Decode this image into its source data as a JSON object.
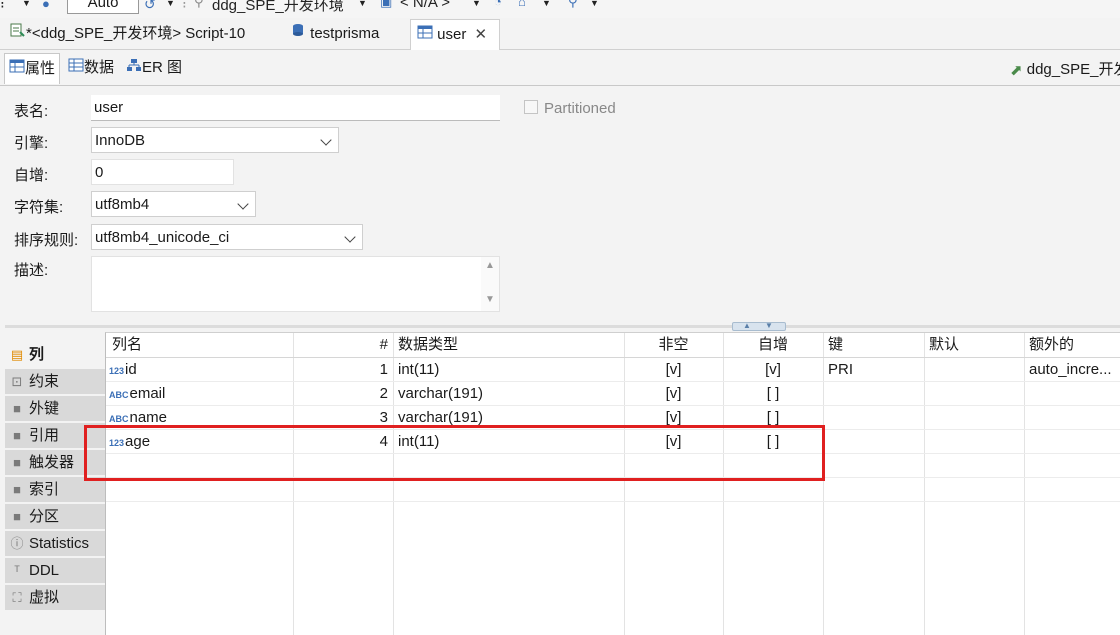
{
  "toolbar": {
    "mode_value": "Auto",
    "connection_label": "ddg_SPE_开发环境",
    "schema_label": "< N/A >"
  },
  "editor_tabs": [
    {
      "label": "*<ddg_SPE_开发环境> Script-10",
      "icon": "sql-script-icon"
    },
    {
      "label": "testprisma",
      "icon": "database-icon"
    },
    {
      "label": "user",
      "icon": "table-icon",
      "active": true
    }
  ],
  "sub_tabs": [
    {
      "label": "属性",
      "icon": "properties-icon",
      "active": true
    },
    {
      "label": "数据",
      "icon": "data-icon"
    },
    {
      "label": "ER 图",
      "icon": "er-diagram-icon"
    }
  ],
  "connection_info": "ddg_SPE_开发",
  "form": {
    "table_name_label": "表名:",
    "table_name_value": "user",
    "partitioned_label": "Partitioned",
    "engine_label": "引擎:",
    "engine_value": "InnoDB",
    "auto_inc_label": "自增:",
    "auto_inc_value": "0",
    "charset_label": "字符集:",
    "charset_value": "utf8mb4",
    "collation_label": "排序规则:",
    "collation_value": "utf8mb4_unicode_ci",
    "description_label": "描述:",
    "description_value": ""
  },
  "left_nav": [
    {
      "label": "列",
      "icon": "columns-icon",
      "active": true
    },
    {
      "label": "约束",
      "icon": "constraint-icon"
    },
    {
      "label": "外键",
      "icon": "folder-icon"
    },
    {
      "label": "引用",
      "icon": "folder-icon"
    },
    {
      "label": "触发器",
      "icon": "folder-icon"
    },
    {
      "label": "索引",
      "icon": "folder-icon"
    },
    {
      "label": "分区",
      "icon": "folder-icon"
    },
    {
      "label": "Statistics",
      "icon": "info-icon"
    },
    {
      "label": "DDL",
      "icon": "ddl-icon"
    },
    {
      "label": "虚拟",
      "icon": "virtual-icon"
    }
  ],
  "grid": {
    "headers": {
      "name": "列名",
      "num": "#",
      "type": "数据类型",
      "not_null": "非空",
      "auto_inc": "自增",
      "key": "键",
      "default": "默认",
      "extra": "额外的"
    },
    "rows": [
      {
        "type_icon": "123",
        "name": "id",
        "num": "1",
        "type": "int(11)",
        "not_null": "[v]",
        "auto_inc": "[v]",
        "key": "PRI",
        "default": "",
        "extra": "auto_incre..."
      },
      {
        "type_icon": "ABC",
        "name": "email",
        "num": "2",
        "type": "varchar(191)",
        "not_null": "[v]",
        "auto_inc": "[ ]",
        "key": "",
        "default": "",
        "extra": ""
      },
      {
        "type_icon": "ABC",
        "name": "name",
        "num": "3",
        "type": "varchar(191)",
        "not_null": "[v]",
        "auto_inc": "[ ]",
        "key": "",
        "default": "",
        "extra": ""
      },
      {
        "type_icon": "123",
        "name": "age",
        "num": "4",
        "type": "int(11)",
        "not_null": "[v]",
        "auto_inc": "[ ]",
        "key": "",
        "default": "",
        "extra": ""
      }
    ]
  },
  "colors": {
    "highlight": "#e02020",
    "accent": "#3b6fb6"
  }
}
